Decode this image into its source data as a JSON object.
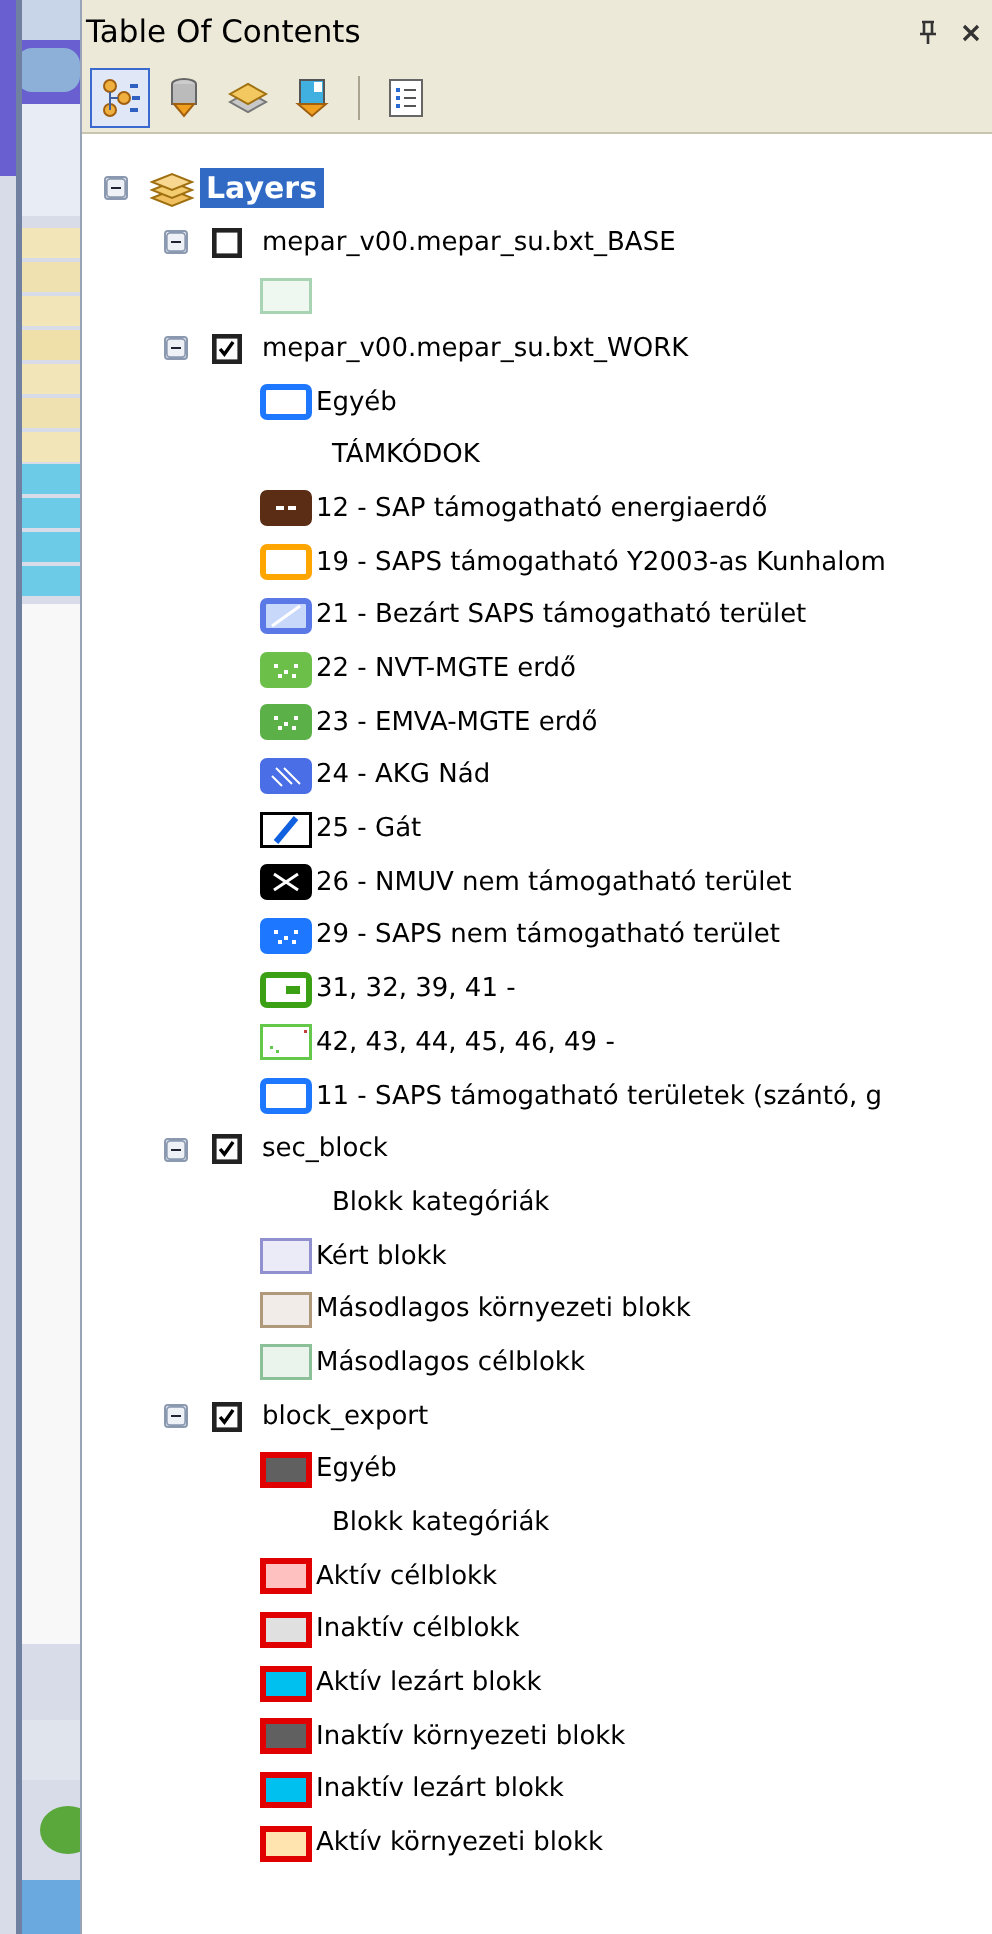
{
  "toc": {
    "title": "Table Of Contents",
    "toolbar": [
      {
        "kind": "drawing-order",
        "selected": true
      },
      {
        "kind": "source",
        "selected": false
      },
      {
        "kind": "visibility",
        "selected": false
      },
      {
        "kind": "selection",
        "selected": false
      },
      {
        "kind": "options",
        "selected": false
      }
    ],
    "root": {
      "label": "Layers",
      "selected": true,
      "expanded": true,
      "layers": [
        {
          "name": "mepar_v00.mepar_su.bxt_BASE",
          "checked": false,
          "expanded": true,
          "legend": [
            {
              "kind": "tinted",
              "color": "#a8d4b4"
            }
          ]
        },
        {
          "name": "mepar_v00.mepar_su.bxt_WORK",
          "checked": true,
          "expanded": true,
          "legend": [
            {
              "kind": "outline",
              "label": "Egyéb",
              "color": "#1e78ff"
            },
            {
              "kind": "heading",
              "label": "TÁMKÓDOK"
            },
            {
              "kind": "dashes",
              "label": "12 - SAP támogatható energiaerdő",
              "color": "#5a2d14"
            },
            {
              "kind": "outline",
              "label": "19 - SAPS támogatható Y2003-as Kunhalom",
              "color": "#ffa500"
            },
            {
              "kind": "striped",
              "label": "21 - Bezárt SAPS támogatható terület",
              "color": "#5a78e6"
            },
            {
              "kind": "dotted",
              "label": "22 - NVT-MGTE erdő",
              "color": "#6cc04a"
            },
            {
              "kind": "dotted",
              "label": "23 - EMVA-MGTE erdő",
              "color": "#5cb048"
            },
            {
              "kind": "hatched",
              "label": "24 - AKG Nád",
              "color": "#4a6ee6"
            },
            {
              "kind": "slashed",
              "label": "25 - Gát",
              "color": "#1060e0"
            },
            {
              "kind": "crossed",
              "label": "26 - NMUV nem támogatható terület",
              "color": "#000000"
            },
            {
              "kind": "dotted",
              "label": "29 - SAPS nem támogatható terület",
              "color": "#1e78ff"
            },
            {
              "kind": "boxed",
              "label": "31, 32, 39, 41 -",
              "color": "#3ca014"
            },
            {
              "kind": "specked",
              "label": "42, 43, 44, 45, 46, 49 -",
              "color": "#64c84a"
            },
            {
              "kind": "outline",
              "label": "11 - SAPS támogatható területek (szántó, g",
              "color": "#1e78ff"
            }
          ]
        },
        {
          "name": "sec_block",
          "checked": true,
          "expanded": true,
          "legend": [
            {
              "kind": "heading",
              "label": "Blokk kategóriák"
            },
            {
              "kind": "tinted",
              "label": "Kért blokk",
              "color": "#9090d0"
            },
            {
              "kind": "tinted",
              "label": "Másodlagos környezeti blokk",
              "color": "#b0987a"
            },
            {
              "kind": "tinted",
              "label": "Másodlagos célblokk",
              "color": "#8cc098"
            }
          ]
        },
        {
          "name": "block_export",
          "checked": true,
          "expanded": true,
          "legend": [
            {
              "kind": "framed",
              "label": "Egyéb",
              "color": "#606060"
            },
            {
              "kind": "heading",
              "label": "Blokk kategóriák"
            },
            {
              "kind": "framed",
              "label": "Aktív célblokk",
              "color": "#ffc0c0"
            },
            {
              "kind": "framed",
              "label": "Inaktív célblokk",
              "color": "#e0e0e0"
            },
            {
              "kind": "framed",
              "label": "Aktív lezárt blokk",
              "color": "#00c0f0"
            },
            {
              "kind": "framed",
              "label": "Inaktív környezeti blokk",
              "color": "#606060"
            },
            {
              "kind": "framed",
              "label": "Inaktív lezárt blokk",
              "color": "#00c0f0"
            },
            {
              "kind": "framed",
              "label": "Aktív környezeti blokk",
              "color": "#ffe4b0"
            }
          ]
        }
      ]
    }
  }
}
